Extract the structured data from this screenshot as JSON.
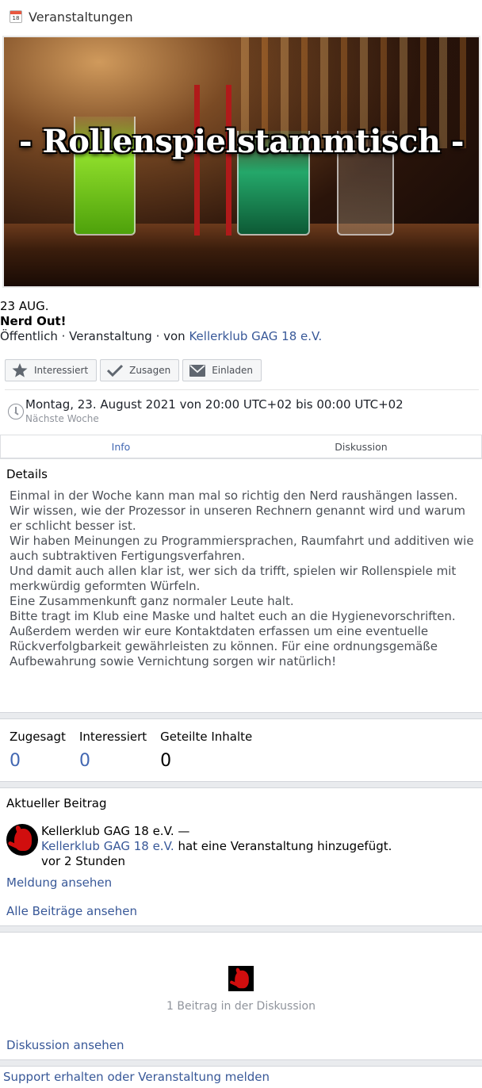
{
  "header": {
    "icon": "calendar-icon",
    "icon_day": "18",
    "title": "Veranstaltungen"
  },
  "cover": {
    "title": "- Rollenspielstammtisch -"
  },
  "event": {
    "date": "23 AUG.",
    "name": "Nerd Out!",
    "meta_prefix": "Öffentlich · Veranstaltung · von ",
    "host": "Kellerklub GAG 18 e.V."
  },
  "actions": {
    "interested": "Interessiert",
    "going": "Zusagen",
    "invite": "Einladen"
  },
  "when": {
    "main": "Montag, 23. August 2021 von 20:00 UTC+02 bis 00:00 UTC+02",
    "sub": "Nächste Woche"
  },
  "tabs": [
    {
      "label": "Info"
    },
    {
      "label": "Diskussion"
    }
  ],
  "details": {
    "heading": "Details",
    "lines": [
      "Einmal in der Woche kann man mal so richtig den Nerd raushängen lassen.",
      "Wir wissen, wie der Prozessor in unseren Rechnern genannt wird und warum er schlicht besser ist.",
      "Wir haben Meinungen zu Programmiersprachen, Raumfahrt und additiven wie auch subtraktiven Fertigungsverfahren.",
      "Und damit auch allen klar ist, wer sich da trifft, spielen wir Rollenspiele mit merkwürdig geformten Würfeln.",
      "Eine Zusammenkunft ganz normaler Leute halt.",
      "Bitte tragt im Klub eine Maske und haltet euch an die Hygienevorschriften.",
      "Außerdem werden wir eure Kontaktdaten erfassen um eine eventuelle Rückverfolgbarkeit gewährleisten zu können. Für eine ordnungsgemäße Aufbewahrung sowie Vernichtung sorgen wir natürlich!"
    ]
  },
  "stats": [
    {
      "label": "Zugesagt",
      "value": "0"
    },
    {
      "label": "Interessiert",
      "value": "0"
    },
    {
      "label": "Geteilte Inhalte",
      "value": "0"
    }
  ],
  "recent": {
    "heading": "Aktueller Beitrag",
    "author_line": "Kellerklub GAG 18 e.V. —",
    "actor": "Kellerklub GAG 18 e.V.",
    "action": " hat eine Veranstaltung hinzugefügt.",
    "time": "vor 2 Stunden",
    "view_report": "Meldung ansehen",
    "view_all": "Alle Beiträge ansehen"
  },
  "discussion": {
    "count_text": "1 Beitrag in der Diskussion",
    "view": "Diskussion ansehen"
  },
  "footer": {
    "support": "Support erhalten oder Veranstaltung melden"
  }
}
